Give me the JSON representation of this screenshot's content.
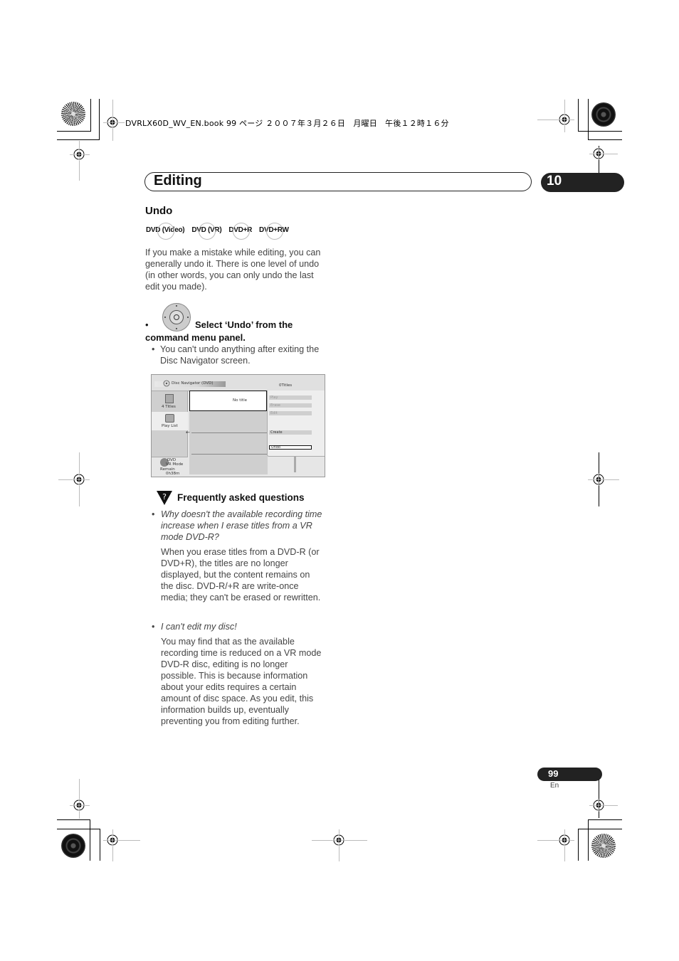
{
  "print_header": "DVRLX60D_WV_EN.book  99 ページ  ２００７年３月２６日　月曜日　午後１２時１６分",
  "chapter": {
    "title": "Editing",
    "number": "10"
  },
  "section": {
    "title": "Undo",
    "badges": [
      "DVD (Video)",
      "DVD (VR)",
      "DVD+R",
      "DVD+RW"
    ],
    "intro_lines": [
      "If you make a mistake while editing, you can",
      "generally undo it. There is one level of undo",
      "(in other words, you can only undo the last",
      "edit you made)."
    ],
    "step": {
      "bullet": "•",
      "icon": "remote-joystick-icon",
      "line1": "Select ‘Undo’ from the",
      "line2": "command menu panel."
    },
    "note": {
      "bullet": "•",
      "lines": [
        "You can't undo anything after exiting the",
        "Disc Navigator screen."
      ]
    }
  },
  "screen": {
    "title": "Disc Navigator (DVD)",
    "count": "0Titles",
    "tabs": [
      {
        "label": "4 Titles",
        "icon": "titles-list-icon"
      },
      {
        "label": "Play List",
        "icon": "playlist-icon"
      }
    ],
    "selected_item": "No title",
    "menu": [
      {
        "label": "Play",
        "state": "disabled"
      },
      {
        "label": "Erase",
        "state": "disabled"
      },
      {
        "label": "Edit",
        "state": "disabled"
      },
      {
        "label": "Create",
        "state": "enabled"
      },
      {
        "label": "Undo",
        "state": "focused"
      }
    ],
    "disc": {
      "line1": "DVD",
      "line2": "VR Mode",
      "remain_label": "Remain",
      "remain_value": "0h38m"
    }
  },
  "faq": {
    "title": "Frequently asked questions",
    "icon": "faq-question-icon",
    "items": [
      {
        "question_lines": [
          "Why doesn't the available recording time",
          "increase when I erase titles from a VR",
          "mode DVD-R?"
        ],
        "answer_lines": [
          "When you erase titles from a DVD-R (or",
          "DVD+R), the titles are no longer",
          "displayed, but the content remains on",
          "the disc. DVD-R/+R are write-once",
          "media; they can't be erased or rewritten."
        ]
      },
      {
        "question_lines": [
          "I can't edit my disc!"
        ],
        "answer_lines": [
          "You may find that as the available",
          "recording time is reduced on a VR mode",
          "DVD-R disc, editing is no longer",
          "possible. This is because information",
          "about your edits requires a certain",
          "amount of disc space. As you edit, this",
          "information builds up, eventually",
          "preventing you from editing further."
        ]
      }
    ]
  },
  "footer": {
    "page_number": "99",
    "language": "En"
  }
}
